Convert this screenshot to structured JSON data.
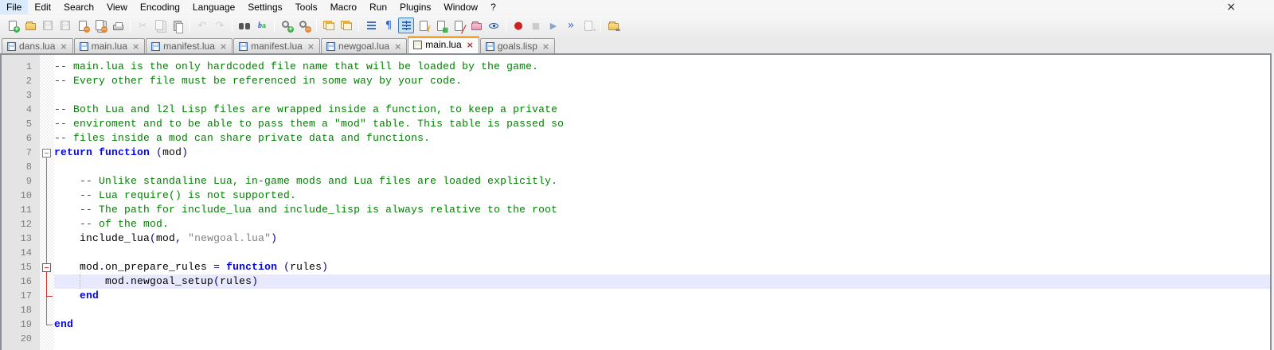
{
  "window": {
    "close_glyph": "×"
  },
  "menu": {
    "items": [
      "File",
      "Edit",
      "Search",
      "View",
      "Encoding",
      "Language",
      "Settings",
      "Tools",
      "Macro",
      "Run",
      "Plugins",
      "Window",
      "?"
    ]
  },
  "toolbar": {
    "items": [
      {
        "name": "new-file-icon",
        "kind": "doc",
        "badge": "plus"
      },
      {
        "name": "open-file-icon",
        "kind": "folder"
      },
      {
        "name": "save-icon",
        "kind": "floppy",
        "disabled": true
      },
      {
        "name": "save-all-icon",
        "kind": "floppy",
        "disabled": true
      },
      {
        "name": "close-icon",
        "kind": "doc",
        "badge": "minus"
      },
      {
        "name": "close-all-icon",
        "kind": "docs",
        "badge": "minus"
      },
      {
        "name": "print-icon",
        "kind": "printer"
      },
      {
        "sep": true
      },
      {
        "name": "cut-icon",
        "kind": "glyph",
        "glyph": "scissors",
        "disabled": true
      },
      {
        "name": "copy-icon",
        "kind": "docs",
        "disabled": true
      },
      {
        "name": "paste-icon",
        "kind": "clip"
      },
      {
        "sep": true
      },
      {
        "name": "undo-icon",
        "kind": "glyph",
        "glyph": "undo",
        "disabled": true
      },
      {
        "name": "redo-icon",
        "kind": "glyph",
        "glyph": "redo",
        "disabled": true
      },
      {
        "sep": true
      },
      {
        "name": "find-icon",
        "kind": "binoc"
      },
      {
        "name": "replace-icon",
        "kind": "replace"
      },
      {
        "sep": true
      },
      {
        "name": "zoom-in-icon",
        "kind": "mag",
        "badge": "plus"
      },
      {
        "name": "zoom-out-icon",
        "kind": "mag",
        "badge": "minus"
      },
      {
        "sep": true
      },
      {
        "name": "sync-vertical-scroll-icon",
        "kind": "sync"
      },
      {
        "name": "sync-horizontal-scroll-icon",
        "kind": "sync"
      },
      {
        "sep": true
      },
      {
        "name": "word-wrap-icon",
        "kind": "wrap"
      },
      {
        "name": "show-all-characters-icon",
        "kind": "glyph",
        "glyph": "pilcrow"
      },
      {
        "name": "show-indent-guide-icon",
        "kind": "guide",
        "active": true
      },
      {
        "name": "function-list-icon",
        "kind": "doc",
        "badge": "fl"
      },
      {
        "name": "user-defined-language-icon",
        "kind": "doc",
        "badge": "grid"
      },
      {
        "name": "document-map-icon",
        "kind": "doc",
        "badge": "pen"
      },
      {
        "name": "doc-switcher-icon",
        "kind": "folder-pink"
      },
      {
        "name": "monitoring-icon",
        "kind": "eye"
      },
      {
        "sep": true
      },
      {
        "name": "macro-record-icon",
        "kind": "glyph",
        "glyph": "record"
      },
      {
        "name": "macro-stop-icon",
        "kind": "glyph",
        "glyph": "stop",
        "disabled": true
      },
      {
        "name": "macro-play-icon",
        "kind": "glyph",
        "glyph": "play"
      },
      {
        "name": "macro-run-multiple-icon",
        "kind": "glyph",
        "glyph": "ff"
      },
      {
        "name": "macro-save-icon",
        "kind": "doc",
        "badge": "sq",
        "disabled": true
      },
      {
        "sep": true
      },
      {
        "name": "open-containing-folder-icon",
        "kind": "folder",
        "badge": "link"
      }
    ]
  },
  "tabs": {
    "items": [
      {
        "label": "dans.lua",
        "active": false
      },
      {
        "label": "main.lua",
        "active": false
      },
      {
        "label": "manifest.lua",
        "active": false
      },
      {
        "label": "manifest.lua",
        "active": false
      },
      {
        "label": "newgoal.lua",
        "active": false
      },
      {
        "label": "main.lua",
        "active": true
      },
      {
        "label": "goals.lisp",
        "active": false
      }
    ],
    "close_glyph": "×"
  },
  "editor": {
    "colors": {
      "comment": "#008000",
      "keyword": "#0000FF",
      "string": "#808080",
      "operator": "#000080",
      "plain": "#000000",
      "current_line_bg": "#E8E8FF",
      "line_number": "#808080",
      "gutter_bg": "#E4E4E4",
      "fold_normal": "#808080",
      "fold_active": "#CC3333",
      "active_tab_accent": "#F2920F"
    },
    "lines": [
      {
        "n": 1,
        "tokens": [
          [
            "cm",
            "-- main.lua is the only hardcoded file name that will be loaded by the game."
          ]
        ]
      },
      {
        "n": 2,
        "tokens": [
          [
            "cm",
            "-- Every other file must be referenced in some way by your code."
          ]
        ]
      },
      {
        "n": 3,
        "tokens": []
      },
      {
        "n": 4,
        "tokens": [
          [
            "cm",
            "-- Both Lua and l2l Lisp files are wrapped inside a function, to keep a private"
          ]
        ]
      },
      {
        "n": 5,
        "tokens": [
          [
            "cm",
            "-- enviroment and to be able to pass them a \"mod\" table. This table is passed so"
          ]
        ]
      },
      {
        "n": 6,
        "tokens": [
          [
            "cm",
            "-- files inside a mod can share private data and functions."
          ]
        ]
      },
      {
        "n": 7,
        "tokens": [
          [
            "kw",
            "return"
          ],
          [
            "tx",
            " "
          ],
          [
            "kw",
            "function"
          ],
          [
            "tx",
            " "
          ],
          [
            "op",
            "("
          ],
          [
            "tx",
            "mod"
          ],
          [
            "op",
            ")"
          ]
        ]
      },
      {
        "n": 8,
        "tokens": []
      },
      {
        "n": 9,
        "tokens": [
          [
            "tx",
            "    "
          ],
          [
            "cm",
            "-- Unlike standaline Lua, in-game mods and Lua files are loaded explicitly."
          ]
        ]
      },
      {
        "n": 10,
        "tokens": [
          [
            "tx",
            "    "
          ],
          [
            "cm",
            "-- Lua require() is not supported."
          ]
        ]
      },
      {
        "n": 11,
        "tokens": [
          [
            "tx",
            "    "
          ],
          [
            "cm",
            "-- The path for include_lua and include_lisp is always relative to the root"
          ]
        ]
      },
      {
        "n": 12,
        "tokens": [
          [
            "tx",
            "    "
          ],
          [
            "cm",
            "-- of the mod."
          ]
        ]
      },
      {
        "n": 13,
        "tokens": [
          [
            "tx",
            "    include_lua"
          ],
          [
            "op",
            "("
          ],
          [
            "tx",
            "mod"
          ],
          [
            "op",
            ","
          ],
          [
            "tx",
            " "
          ],
          [
            "st",
            "\"newgoal.lua\""
          ],
          [
            "op",
            ")"
          ]
        ]
      },
      {
        "n": 14,
        "tokens": []
      },
      {
        "n": 15,
        "tokens": [
          [
            "tx",
            "    mod"
          ],
          [
            "op",
            "."
          ],
          [
            "tx",
            "on_prepare_rules "
          ],
          [
            "op",
            "="
          ],
          [
            "tx",
            " "
          ],
          [
            "kw",
            "function"
          ],
          [
            "tx",
            " "
          ],
          [
            "op",
            "("
          ],
          [
            "tx",
            "rules"
          ],
          [
            "op",
            ")"
          ]
        ]
      },
      {
        "n": 16,
        "current": true,
        "guides": [
          4
        ],
        "tokens": [
          [
            "tx",
            "        mod"
          ],
          [
            "op",
            "."
          ],
          [
            "tx",
            "newgoal_setup"
          ],
          [
            "op",
            "("
          ],
          [
            "tx",
            "rules"
          ],
          [
            "op",
            ")"
          ]
        ]
      },
      {
        "n": 17,
        "tokens": [
          [
            "tx",
            "    "
          ],
          [
            "kw",
            "end"
          ]
        ]
      },
      {
        "n": 18,
        "tokens": []
      },
      {
        "n": 19,
        "tokens": [
          [
            "kw",
            "end"
          ]
        ]
      },
      {
        "n": 20,
        "tokens": []
      }
    ],
    "fold": {
      "boxes": [
        {
          "line": 7,
          "color": "#808080"
        },
        {
          "line": 15,
          "color": "#CC3333"
        }
      ],
      "rails": [
        {
          "from": 7,
          "to": 19,
          "color": "#808080"
        },
        {
          "from": 15,
          "to": 17,
          "color": "#CC3333"
        }
      ],
      "corners": [
        {
          "line": 17,
          "color": "#CC3333"
        },
        {
          "line": 19,
          "color": "#808080"
        }
      ]
    }
  }
}
